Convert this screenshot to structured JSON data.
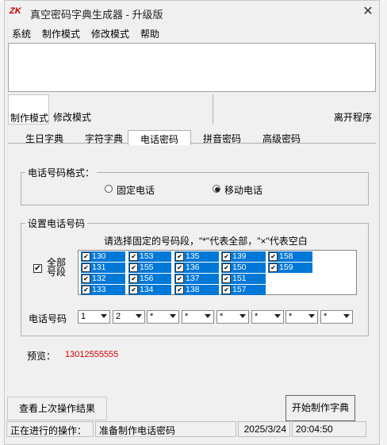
{
  "window": {
    "title": "真空密码字典生成器 - 升级版",
    "app_icon_text": "ZK"
  },
  "menu": [
    "系统",
    "制作模式",
    "修改模式",
    "帮助"
  ],
  "toolbar": {
    "make_mode": "制作模式",
    "edit_mode": "修改模式",
    "exit": "离开程序"
  },
  "tabs": [
    "生日字典",
    "字符字典",
    "电话密码",
    "拼音密码",
    "高级密码"
  ],
  "phone_format": {
    "label": "电话号码格式：",
    "options": [
      {
        "label": "固定电话",
        "selected": false
      },
      {
        "label": "移动电话",
        "selected": true
      }
    ]
  },
  "settings": {
    "label": "设置电话号码",
    "hint": "请选择固定的号码段，\"*\"代表全部，\"×\"代表空白",
    "all_label_1": "全部",
    "all_label_2": "号段",
    "all_checked": true,
    "prefixes": [
      [
        "130",
        "131",
        "132",
        "133"
      ],
      [
        "153",
        "155",
        "156",
        "134"
      ],
      [
        "135",
        "136",
        "137",
        "138"
      ],
      [
        "139",
        "150",
        "151",
        "157"
      ],
      [
        "158",
        "159"
      ]
    ]
  },
  "number": {
    "label": "电话号码",
    "digits": [
      "1",
      "2",
      "*",
      "*",
      "*",
      "*",
      "*",
      "*"
    ]
  },
  "preview": {
    "label": "预览：",
    "value": "13012555555",
    "color": "#cc0000"
  },
  "buttons": {
    "last_result": "查看上次操作结果",
    "start": "开始制作字典"
  },
  "status": {
    "label": "正在进行的操作：",
    "op": "准备制作电话密码",
    "date": "2025/3/24",
    "time": "20:04:50"
  },
  "colors": {
    "selection": "#0078d7"
  }
}
